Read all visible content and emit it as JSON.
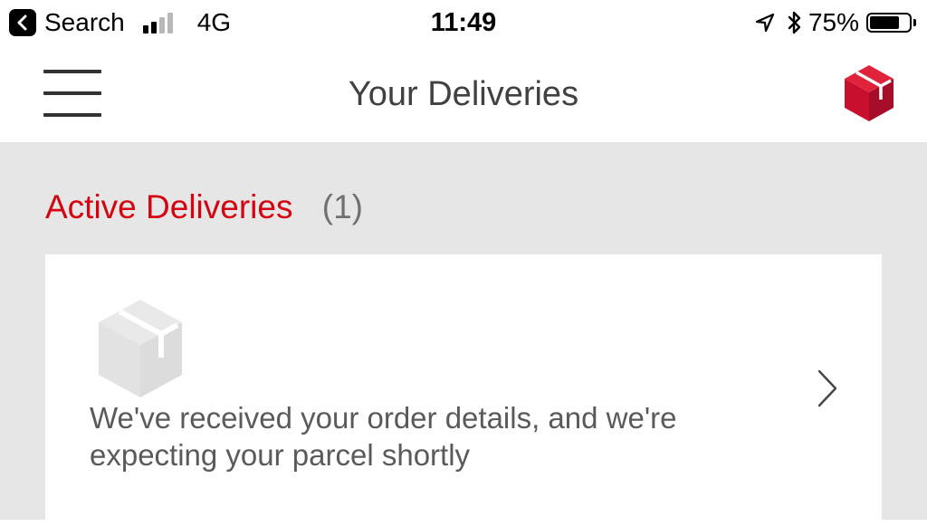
{
  "status_bar": {
    "back_label": "Search",
    "network": "4G",
    "time": "11:49",
    "battery_percent": "75%",
    "battery_level": 0.75,
    "signal_bars_active": 2,
    "signal_bars_total": 4,
    "icons": [
      "back-icon",
      "signal-icon",
      "location-arrow-icon",
      "bluetooth-icon",
      "battery-icon"
    ]
  },
  "header": {
    "title": "Your Deliveries",
    "menu_icon": "hamburger-menu-icon",
    "logo_icon": "dpd-cube-logo"
  },
  "section": {
    "title": "Active Deliveries",
    "count": "(1)"
  },
  "delivery_card": {
    "icon": "parcel-box-icon",
    "message": "We've received your order details, and we're expecting your parcel shortly",
    "chevron_icon": "chevron-right-icon"
  },
  "colors": {
    "accent_red": "#d40511",
    "background_grey": "#e6e6e6",
    "card_white": "#ffffff",
    "muted_text": "#707070"
  }
}
